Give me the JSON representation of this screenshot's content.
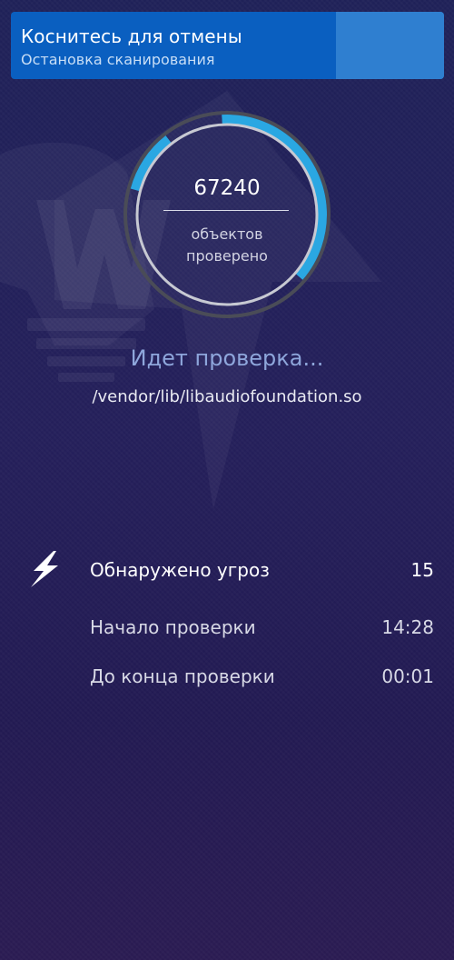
{
  "banner": {
    "title": "Коснитесь для отмены",
    "subtitle": "Остановка сканирования"
  },
  "scan": {
    "objects_count": "67240",
    "objects_label_line1": "объектов",
    "objects_label_line2": "проверено",
    "status": "Идет проверка...",
    "current_file": "/vendor/lib/libaudiofoundation.so"
  },
  "stats": [
    {
      "label": "Обнаружено угроз",
      "value": "15"
    },
    {
      "label": "Начало проверки",
      "value": "14:28"
    },
    {
      "label": "До конца проверки",
      "value": "00:01"
    }
  ],
  "icons": {
    "threat": "lightning-bolt-icon",
    "watermark": "spider-logo-icon"
  },
  "colors": {
    "banner": "#0a5fc0",
    "banner_side": "#2f7fd0",
    "ring_progress": "#2aa7e2",
    "status_text": "#8ea6db"
  }
}
